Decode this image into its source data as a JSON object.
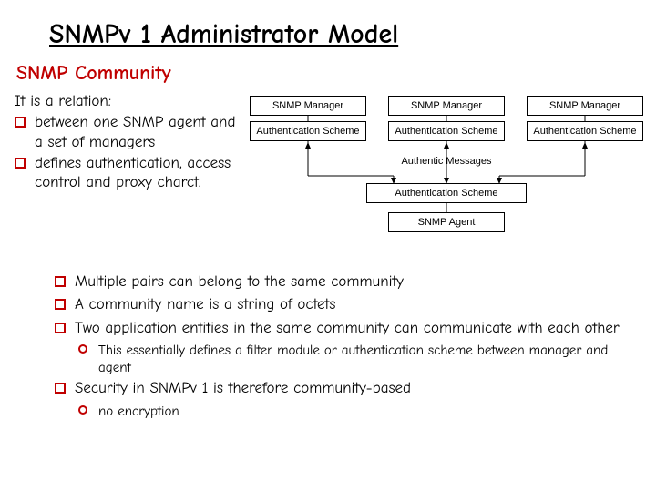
{
  "title": "SNMPv 1 Administrator Model",
  "subtitle": "SNMP Community",
  "intro": "It is a relation:",
  "defs": [
    "between one SNMP agent and a set of managers",
    "defines authentication, access control and proxy charct."
  ],
  "diagram": {
    "manager": "SNMP Manager",
    "auth": "Authentication Scheme",
    "messages": "Authentic Messages",
    "agentAuth": "Authentication Scheme",
    "agent": "SNMP Agent"
  },
  "lower": [
    "Multiple pairs can belong to the same community",
    "A community name is a string of octets",
    "Two application entities in the same community can communicate with each other"
  ],
  "sub1": "This essentially defines a filter module or authentication scheme between manager and agent",
  "lower4": "Security in SNMPv 1 is therefore community-based",
  "sub2": "no encryption"
}
